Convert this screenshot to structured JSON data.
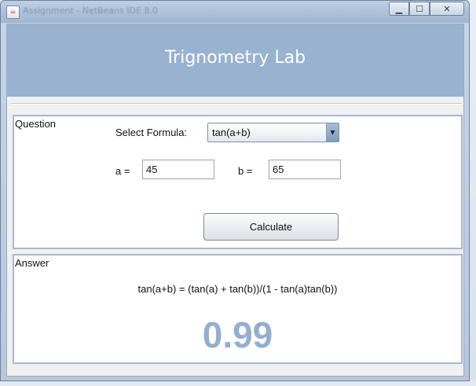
{
  "window": {
    "title": "Assignment - NetBeans IDE 8.0",
    "controls": {
      "minimize": "▁",
      "maximize": "☐",
      "close": "✕"
    }
  },
  "header": {
    "title": "Trignometry Lab"
  },
  "question": {
    "panel_label": "Question",
    "select_formula_label": "Select Formula:",
    "formula_selected": "tan(a+b)",
    "a_label": "a =",
    "a_value": "45",
    "b_label": "b =",
    "b_value": "65",
    "calculate_label": "Calculate"
  },
  "answer": {
    "panel_label": "Answer",
    "formula_text": "tan(a+b) = (tan(a) + tan(b))/(1 - tan(a)tan(b))",
    "result": "0.99"
  },
  "colors": {
    "header_bg": "#98b2d0",
    "panel_border": "#a3b9d2",
    "result_text": "#93afcd"
  },
  "icons": {
    "app": "java-icon",
    "dropdown": "chevron-down-icon"
  }
}
